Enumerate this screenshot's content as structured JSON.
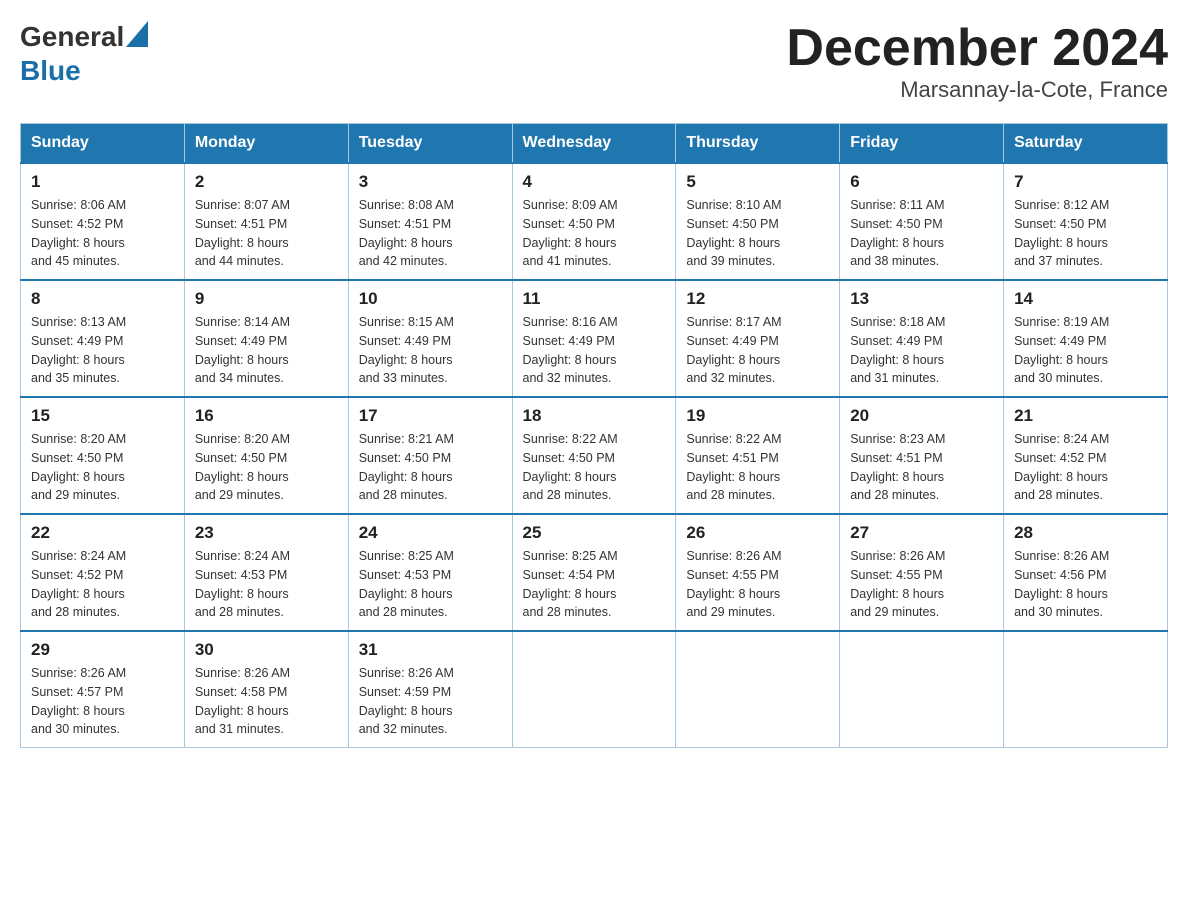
{
  "header": {
    "logo_general": "General",
    "logo_blue": "Blue",
    "month_title": "December 2024",
    "location": "Marsannay-la-Cote, France"
  },
  "weekdays": [
    "Sunday",
    "Monday",
    "Tuesday",
    "Wednesday",
    "Thursday",
    "Friday",
    "Saturday"
  ],
  "weeks": [
    [
      {
        "day": "1",
        "sunrise": "8:06 AM",
        "sunset": "4:52 PM",
        "daylight": "8 hours and 45 minutes."
      },
      {
        "day": "2",
        "sunrise": "8:07 AM",
        "sunset": "4:51 PM",
        "daylight": "8 hours and 44 minutes."
      },
      {
        "day": "3",
        "sunrise": "8:08 AM",
        "sunset": "4:51 PM",
        "daylight": "8 hours and 42 minutes."
      },
      {
        "day": "4",
        "sunrise": "8:09 AM",
        "sunset": "4:50 PM",
        "daylight": "8 hours and 41 minutes."
      },
      {
        "day": "5",
        "sunrise": "8:10 AM",
        "sunset": "4:50 PM",
        "daylight": "8 hours and 39 minutes."
      },
      {
        "day": "6",
        "sunrise": "8:11 AM",
        "sunset": "4:50 PM",
        "daylight": "8 hours and 38 minutes."
      },
      {
        "day": "7",
        "sunrise": "8:12 AM",
        "sunset": "4:50 PM",
        "daylight": "8 hours and 37 minutes."
      }
    ],
    [
      {
        "day": "8",
        "sunrise": "8:13 AM",
        "sunset": "4:49 PM",
        "daylight": "8 hours and 35 minutes."
      },
      {
        "day": "9",
        "sunrise": "8:14 AM",
        "sunset": "4:49 PM",
        "daylight": "8 hours and 34 minutes."
      },
      {
        "day": "10",
        "sunrise": "8:15 AM",
        "sunset": "4:49 PM",
        "daylight": "8 hours and 33 minutes."
      },
      {
        "day": "11",
        "sunrise": "8:16 AM",
        "sunset": "4:49 PM",
        "daylight": "8 hours and 32 minutes."
      },
      {
        "day": "12",
        "sunrise": "8:17 AM",
        "sunset": "4:49 PM",
        "daylight": "8 hours and 32 minutes."
      },
      {
        "day": "13",
        "sunrise": "8:18 AM",
        "sunset": "4:49 PM",
        "daylight": "8 hours and 31 minutes."
      },
      {
        "day": "14",
        "sunrise": "8:19 AM",
        "sunset": "4:49 PM",
        "daylight": "8 hours and 30 minutes."
      }
    ],
    [
      {
        "day": "15",
        "sunrise": "8:20 AM",
        "sunset": "4:50 PM",
        "daylight": "8 hours and 29 minutes."
      },
      {
        "day": "16",
        "sunrise": "8:20 AM",
        "sunset": "4:50 PM",
        "daylight": "8 hours and 29 minutes."
      },
      {
        "day": "17",
        "sunrise": "8:21 AM",
        "sunset": "4:50 PM",
        "daylight": "8 hours and 28 minutes."
      },
      {
        "day": "18",
        "sunrise": "8:22 AM",
        "sunset": "4:50 PM",
        "daylight": "8 hours and 28 minutes."
      },
      {
        "day": "19",
        "sunrise": "8:22 AM",
        "sunset": "4:51 PM",
        "daylight": "8 hours and 28 minutes."
      },
      {
        "day": "20",
        "sunrise": "8:23 AM",
        "sunset": "4:51 PM",
        "daylight": "8 hours and 28 minutes."
      },
      {
        "day": "21",
        "sunrise": "8:24 AM",
        "sunset": "4:52 PM",
        "daylight": "8 hours and 28 minutes."
      }
    ],
    [
      {
        "day": "22",
        "sunrise": "8:24 AM",
        "sunset": "4:52 PM",
        "daylight": "8 hours and 28 minutes."
      },
      {
        "day": "23",
        "sunrise": "8:24 AM",
        "sunset": "4:53 PM",
        "daylight": "8 hours and 28 minutes."
      },
      {
        "day": "24",
        "sunrise": "8:25 AM",
        "sunset": "4:53 PM",
        "daylight": "8 hours and 28 minutes."
      },
      {
        "day": "25",
        "sunrise": "8:25 AM",
        "sunset": "4:54 PM",
        "daylight": "8 hours and 28 minutes."
      },
      {
        "day": "26",
        "sunrise": "8:26 AM",
        "sunset": "4:55 PM",
        "daylight": "8 hours and 29 minutes."
      },
      {
        "day": "27",
        "sunrise": "8:26 AM",
        "sunset": "4:55 PM",
        "daylight": "8 hours and 29 minutes."
      },
      {
        "day": "28",
        "sunrise": "8:26 AM",
        "sunset": "4:56 PM",
        "daylight": "8 hours and 30 minutes."
      }
    ],
    [
      {
        "day": "29",
        "sunrise": "8:26 AM",
        "sunset": "4:57 PM",
        "daylight": "8 hours and 30 minutes."
      },
      {
        "day": "30",
        "sunrise": "8:26 AM",
        "sunset": "4:58 PM",
        "daylight": "8 hours and 31 minutes."
      },
      {
        "day": "31",
        "sunrise": "8:26 AM",
        "sunset": "4:59 PM",
        "daylight": "8 hours and 32 minutes."
      },
      null,
      null,
      null,
      null
    ]
  ],
  "labels": {
    "sunrise": "Sunrise:",
    "sunset": "Sunset:",
    "daylight": "Daylight:"
  }
}
